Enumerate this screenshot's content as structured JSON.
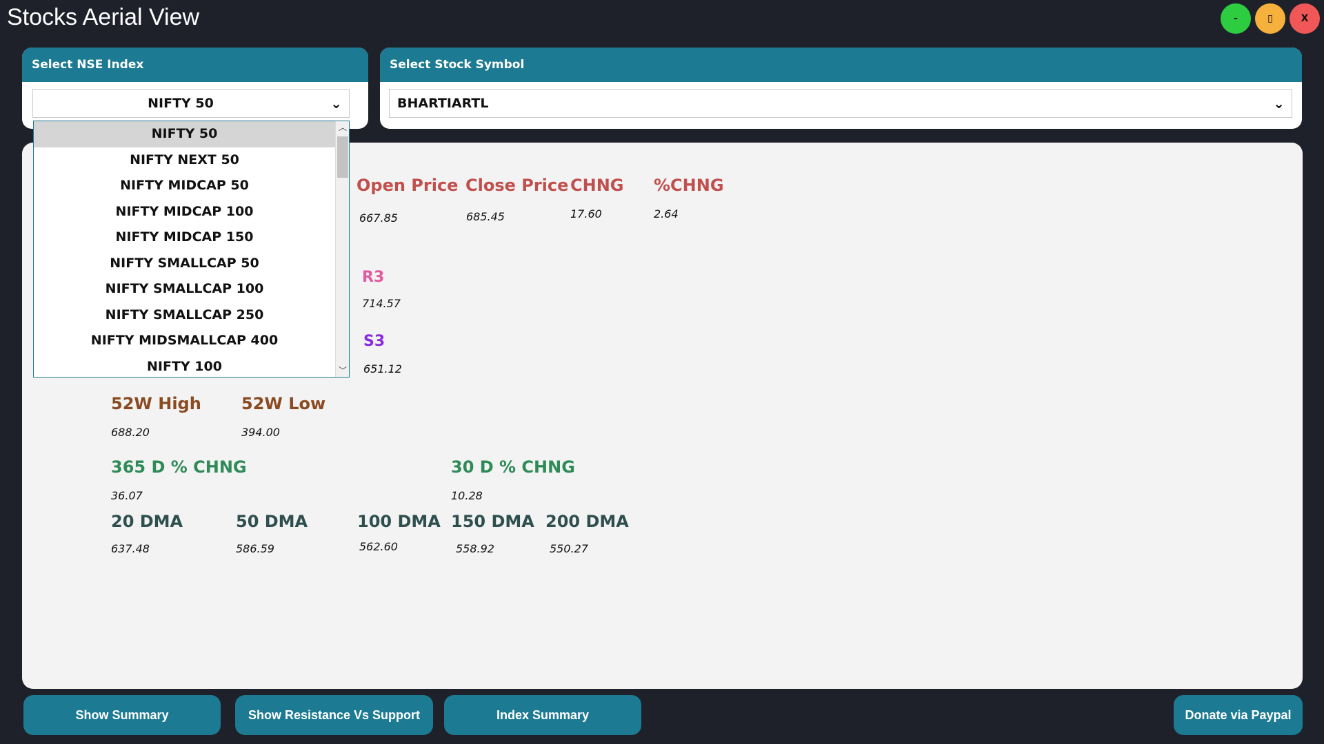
{
  "app": {
    "title": "Stocks Aerial View",
    "window_controls": {
      "minimize": "-",
      "maximize": "▯",
      "close": "X"
    }
  },
  "colors": {
    "background": "#1e212a",
    "accent": "#1c7a92",
    "minimize": "#2ecc40",
    "maximize": "#f6b13c",
    "close": "#f25757"
  },
  "index_selector": {
    "header": "Select NSE Index",
    "selected": "NIFTY 50",
    "options": [
      "NIFTY 50",
      "NIFTY NEXT 50",
      "NIFTY MIDCAP 50",
      "NIFTY MIDCAP 100",
      "NIFTY MIDCAP 150",
      "NIFTY SMALLCAP 50",
      "NIFTY SMALLCAP 100",
      "NIFTY SMALLCAP 250",
      "NIFTY MIDSMALLCAP 400",
      "NIFTY 100"
    ]
  },
  "symbol_selector": {
    "header": "Select Stock Symbol",
    "selected": "BHARTIARTL"
  },
  "stats": {
    "open_price": {
      "label": "Open Price",
      "value": "667.85"
    },
    "close_price": {
      "label": "Close Price",
      "value": "685.45"
    },
    "chng": {
      "label": "CHNG",
      "value": "17.60"
    },
    "pchng": {
      "label": "%CHNG",
      "value": "2.64"
    },
    "r3": {
      "label": "R3",
      "value": "714.57"
    },
    "s3": {
      "label": "S3",
      "value": "651.12"
    },
    "high_52w": {
      "label": "52W High",
      "value": "688.20"
    },
    "low_52w": {
      "label": "52W Low",
      "value": "394.00"
    },
    "chng_365d": {
      "label": "365 D % CHNG",
      "value": "36.07"
    },
    "chng_30d": {
      "label": "30 D % CHNG",
      "value": "10.28"
    },
    "dma_20": {
      "label": "20 DMA",
      "value": "637.48"
    },
    "dma_50": {
      "label": "50 DMA",
      "value": "586.59"
    },
    "dma_100": {
      "label": "100 DMA",
      "value": "562.60"
    },
    "dma_150": {
      "label": "150 DMA",
      "value": "558.92"
    },
    "dma_200": {
      "label": "200 DMA",
      "value": "550.27"
    }
  },
  "buttons": {
    "show_summary": "Show Summary",
    "resistance_support": "Show Resistance Vs Support",
    "index_summary": "Index Summary",
    "donate": "Donate via Paypal"
  }
}
